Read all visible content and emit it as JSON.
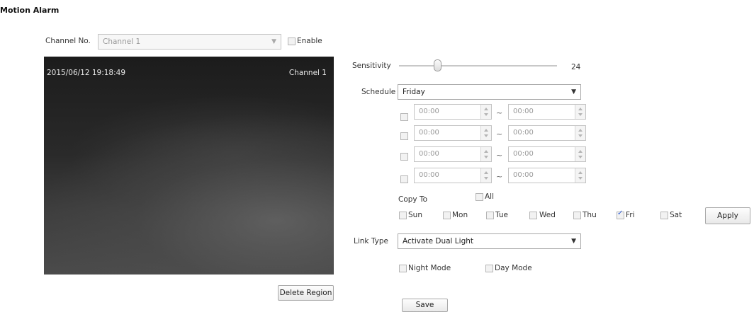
{
  "page": {
    "title": "Motion Alarm"
  },
  "channel": {
    "label": "Channel No.",
    "value": "Channel 1",
    "enable_label": "Enable",
    "enable_checked": false
  },
  "video": {
    "timestamp": "2015/06/12 19:18:49",
    "channel_osd": "Channel 1",
    "delete_region_label": "Delete Region"
  },
  "sensitivity": {
    "label": "Sensitivity",
    "value": "24",
    "fraction": 0.24
  },
  "schedule": {
    "label": "Schedule",
    "day": "Friday",
    "slots": [
      {
        "enabled": false,
        "start": "00:00",
        "end": "00:00"
      },
      {
        "enabled": false,
        "start": "00:00",
        "end": "00:00"
      },
      {
        "enabled": false,
        "start": "00:00",
        "end": "00:00"
      },
      {
        "enabled": false,
        "start": "00:00",
        "end": "00:00"
      }
    ],
    "separator": "~"
  },
  "copy_to": {
    "label": "Copy To",
    "all_label": "All",
    "days": [
      {
        "label": "Sun",
        "checked": false
      },
      {
        "label": "Mon",
        "checked": false
      },
      {
        "label": "Tue",
        "checked": false
      },
      {
        "label": "Wed",
        "checked": false
      },
      {
        "label": "Thu",
        "checked": false
      },
      {
        "label": "Fri",
        "checked": true
      },
      {
        "label": "Sat",
        "checked": false
      }
    ],
    "apply_label": "Apply"
  },
  "link_type": {
    "label": "Link Type",
    "value": "Activate Dual Light",
    "night_mode_label": "Night Mode",
    "day_mode_label": "Day Mode"
  },
  "save_label": "Save"
}
